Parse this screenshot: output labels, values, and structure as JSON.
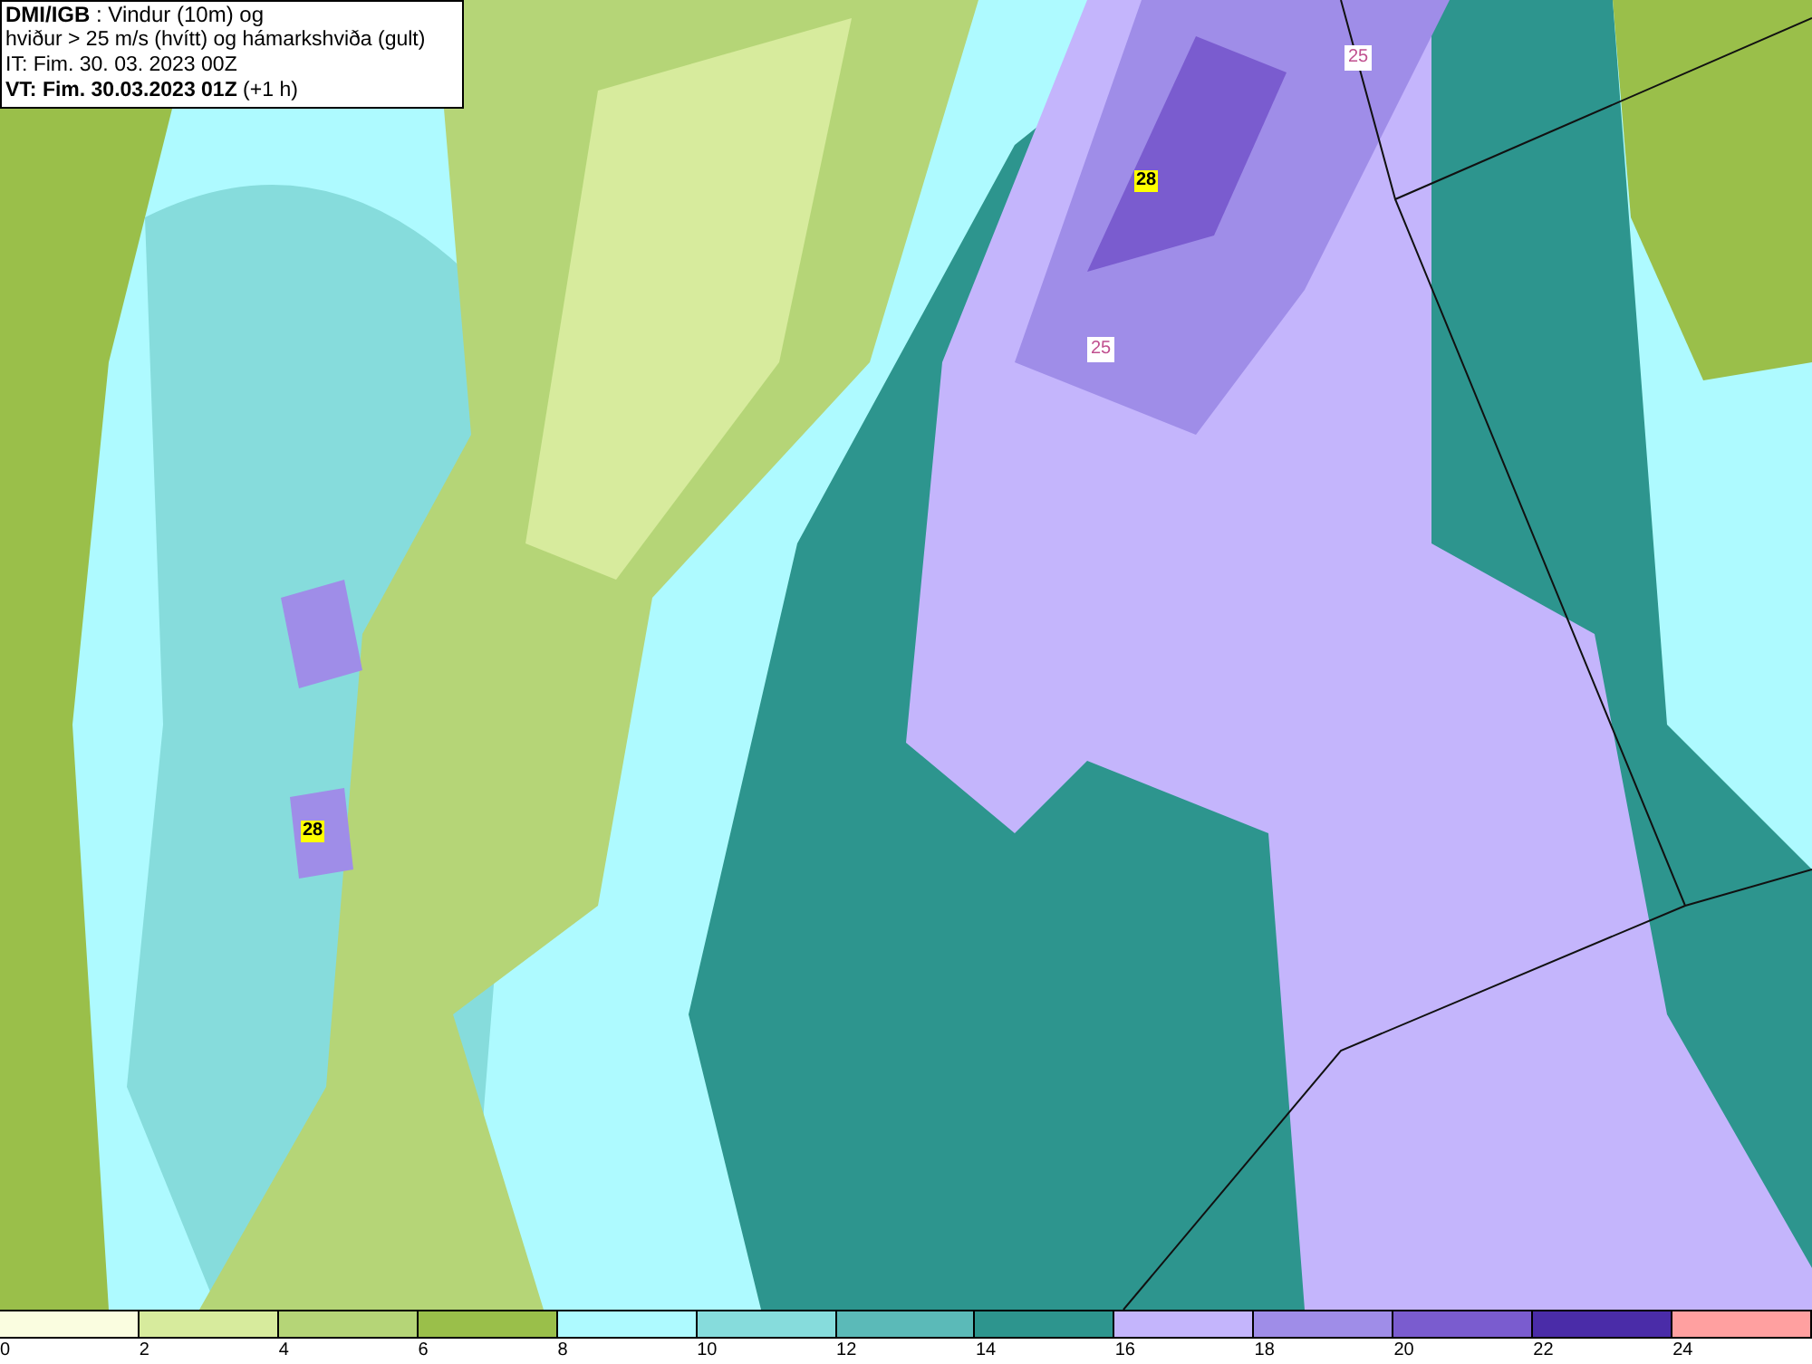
{
  "header": {
    "lines": [
      "**DMI/IGB** : Vindur (10m) og",
      "hviður > 25 m/s (hvítt) og hámarkshviða (gult)",
      "IT: Fim. 30. 03. 2023 00Z",
      "**VT: Fim. 30.03.2023 01Z** (+1 h)"
    ]
  },
  "map": {
    "labels": [
      {
        "text": "25",
        "kind": "gust"
      },
      {
        "text": "28",
        "kind": "max"
      },
      {
        "text": "25",
        "kind": "gust"
      },
      {
        "text": "28",
        "kind": "max"
      }
    ]
  },
  "legend": {
    "swatches": [
      {
        "color": "#fafde0"
      },
      {
        "color": "#d7eb9d"
      },
      {
        "color": "#b5d577"
      },
      {
        "color": "#9abf4a"
      },
      {
        "color": "#aefaff"
      },
      {
        "color": "#86dcdc"
      },
      {
        "color": "#5bbab8"
      },
      {
        "color": "#2d958e"
      },
      {
        "color": "#c4b5fc"
      },
      {
        "color": "#9f8de8"
      },
      {
        "color": "#7a5ccf"
      },
      {
        "color": "#4a2ca8"
      },
      {
        "color": "#ffa0a0"
      }
    ],
    "ticks": [
      "0",
      "2",
      "4",
      "6",
      "8",
      "10",
      "12",
      "14",
      "16",
      "18",
      "20",
      "22",
      "24"
    ]
  }
}
